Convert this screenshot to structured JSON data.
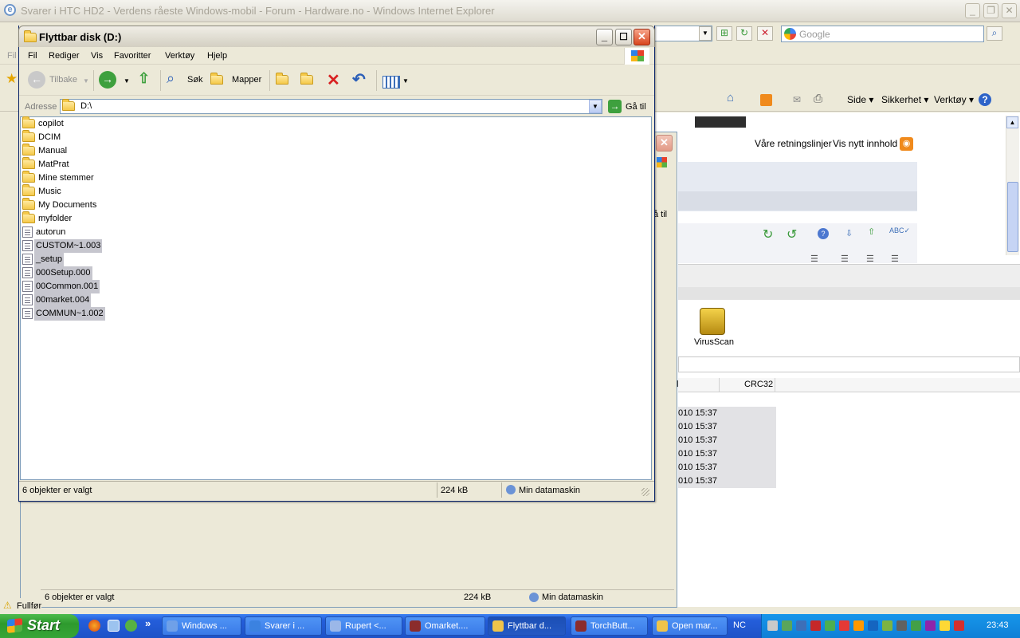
{
  "ie": {
    "title": "Svarer i HTC HD2 - Verdens råeste Windows-mobil - Forum - Hardware.no - Windows Internet Explorer",
    "search_placeholder": "Google",
    "menu_fragment": "Fil",
    "commands": [
      "Side",
      "Sikkerhet",
      "Verktøy"
    ],
    "forum_links": [
      "Våre retningslinjer",
      "Vis nytt innhold"
    ],
    "goto_fragment": "å til",
    "status_fragment": "Fullfør"
  },
  "explorer_back": {
    "virusscan_label": "VirusScan",
    "crc_header": "CRC32",
    "name_header_fragment": "l",
    "dates": [
      "010 15:37",
      "010 15:37",
      "010 15:37",
      "010 15:37",
      "010 15:37",
      "010 15:37"
    ],
    "status_left": "6 objekter er valgt",
    "status_size": "224 kB",
    "status_location": "Min datamaskin"
  },
  "window": {
    "title": "Flyttbar disk (D:)",
    "menu": [
      "Fil",
      "Rediger",
      "Vis",
      "Favoritter",
      "Verktøy",
      "Hjelp"
    ],
    "toolbar": {
      "back": "Tilbake",
      "search": "Søk",
      "folders": "Mapper"
    },
    "address_label": "Adresse",
    "address_value": "D:\\",
    "goto_label": "Gå til",
    "status_left": "6 objekter er valgt",
    "status_size": "224 kB",
    "status_location": "Min datamaskin"
  },
  "files": [
    {
      "name": "copilot",
      "type": "folder",
      "selected": false
    },
    {
      "name": "DCIM",
      "type": "folder",
      "selected": false
    },
    {
      "name": "Manual",
      "type": "folder",
      "selected": false
    },
    {
      "name": "MatPrat",
      "type": "folder",
      "selected": false
    },
    {
      "name": "Mine stemmer",
      "type": "folder",
      "selected": false
    },
    {
      "name": "Music",
      "type": "folder",
      "selected": false
    },
    {
      "name": "My Documents",
      "type": "folder",
      "selected": false
    },
    {
      "name": "myfolder",
      "type": "folder",
      "selected": false
    },
    {
      "name": "autorun",
      "type": "file",
      "selected": false
    },
    {
      "name": "CUSTOM~1.003",
      "type": "file",
      "selected": true
    },
    {
      "name": "_setup",
      "type": "file",
      "selected": true
    },
    {
      "name": "000Setup.000",
      "type": "file",
      "selected": true
    },
    {
      "name": "00Common.001",
      "type": "file",
      "selected": true
    },
    {
      "name": "00market.004",
      "type": "file",
      "selected": true
    },
    {
      "name": "COMMUN~1.002",
      "type": "file",
      "selected": true
    }
  ],
  "taskbar": {
    "start": "Start",
    "tasks": [
      "Windows ...",
      "Svarer i ...",
      "Rupert <...",
      "Omarket....",
      "Flyttbar d...",
      "TorchButt...",
      "Open mar..."
    ],
    "lang": "NC",
    "clock": "23:43"
  },
  "colors": {
    "selection": "#c6c6ce",
    "taskbar": "#245edb",
    "start": "#2e9a2e",
    "close": "#d9461e"
  }
}
